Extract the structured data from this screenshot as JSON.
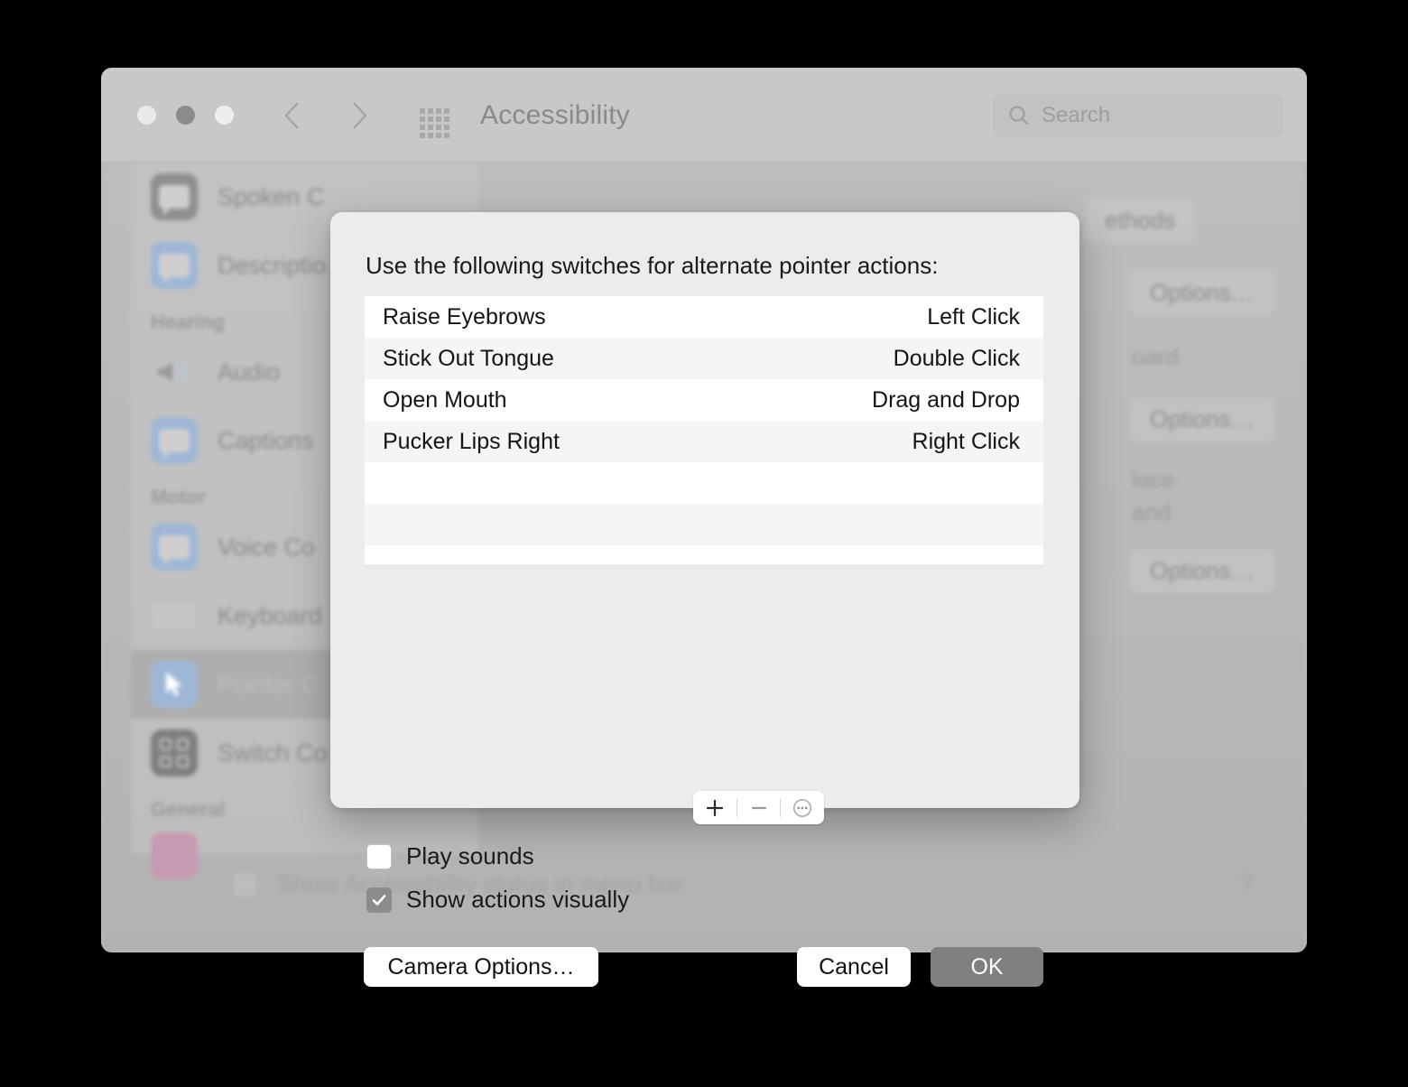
{
  "window": {
    "title": "Accessibility",
    "traffic_lights": [
      "close",
      "minimize",
      "zoom"
    ],
    "nav": {
      "back": "back-chevron",
      "forward": "forward-chevron",
      "grid": "show-all-grid"
    },
    "search": {
      "placeholder": "Search",
      "value": "",
      "icon": "search-icon"
    }
  },
  "sidebar": {
    "items": [
      {
        "label": "Spoken C",
        "icon": "spoken-content-icon",
        "icon_style": "gray",
        "selected": false
      },
      {
        "label": "Descriptio",
        "icon": "descriptions-icon",
        "icon_style": "blue",
        "selected": false
      },
      {
        "label": "Audio",
        "icon": "audio-icon",
        "icon_style": "plain",
        "selected": false
      },
      {
        "label": "Captions",
        "icon": "captions-icon",
        "icon_style": "blue",
        "selected": false
      },
      {
        "label": "Voice Co",
        "icon": "voice-control-icon",
        "icon_style": "blue",
        "selected": false
      },
      {
        "label": "Keyboard",
        "icon": "keyboard-icon",
        "icon_style": "plain",
        "selected": false
      },
      {
        "label": "Pointer C",
        "icon": "pointer-control-icon",
        "icon_style": "blue",
        "selected": true
      },
      {
        "label": "Switch Co",
        "icon": "switch-control-icon",
        "icon_style": "dkgray",
        "selected": false
      }
    ],
    "headers": {
      "hearing": "Hearing",
      "motor": "Motor",
      "general": "General"
    }
  },
  "right_panel": {
    "methods_tab": "ethods",
    "options_1": "Options…",
    "options_2": "Options…",
    "options_3": "Options…",
    "text_1": "oard",
    "text_2": "lace",
    "text_3": "and"
  },
  "window_footer": {
    "status_checkbox_label": "Show Accessibility status in menu bar",
    "status_checkbox_checked": false,
    "help_label": "?"
  },
  "dialog": {
    "title": "Use the following switches for alternate pointer actions:",
    "table": {
      "rows": [
        {
          "switch": "Raise Eyebrows",
          "action": "Left Click"
        },
        {
          "switch": "Stick Out Tongue",
          "action": "Double Click"
        },
        {
          "switch": "Open Mouth",
          "action": "Drag and Drop"
        },
        {
          "switch": "Pucker Lips Right",
          "action": "Right Click"
        },
        {
          "switch": "",
          "action": ""
        },
        {
          "switch": "",
          "action": ""
        },
        {
          "switch": "",
          "action": ""
        }
      ]
    },
    "toolbar": {
      "add": "+",
      "remove": "−",
      "more": "more-options-icon"
    },
    "checkboxes": [
      {
        "label": "Play sounds",
        "checked": false
      },
      {
        "label": "Show actions visually",
        "checked": true
      }
    ],
    "buttons": {
      "camera_options": "Camera Options…",
      "cancel": "Cancel",
      "ok": "OK"
    }
  },
  "colors": {
    "dialog_bg": "#ececec",
    "table_row_even": "#f4f5f5",
    "default_button": "#808080",
    "checkbox_checked": "#8c8c8c",
    "window_chrome": "#c8c8c8"
  }
}
